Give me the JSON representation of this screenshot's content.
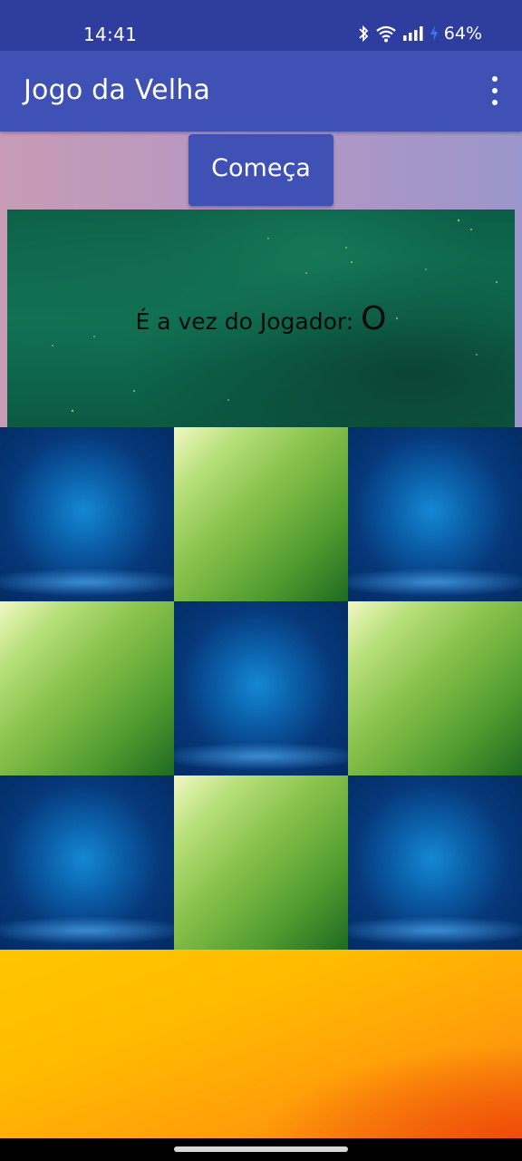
{
  "status_bar": {
    "time": "14:41",
    "battery": "64%",
    "icons": [
      "bluetooth-icon",
      "wifi-icon",
      "signal-icon",
      "charging-icon"
    ]
  },
  "app_bar": {
    "title": "Jogo da Velha",
    "menu_icon": "more-vert-icon",
    "color": "#3f51b5"
  },
  "controls": {
    "start_label": "Começa"
  },
  "turn": {
    "label": "É a vez do Jogador:",
    "player": "O"
  },
  "board": {
    "cells": [
      "",
      "",
      "",
      "",
      "",
      "",
      "",
      "",
      ""
    ]
  },
  "colors": {
    "primary": "#3f51b5",
    "status_bar": "#2f3e9e"
  }
}
